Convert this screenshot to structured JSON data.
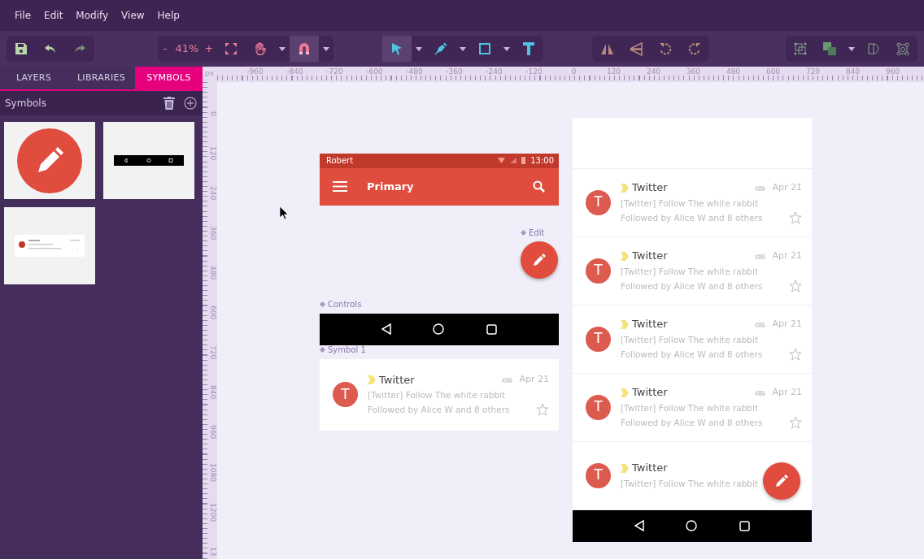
{
  "menu": [
    "File",
    "Edit",
    "Modify",
    "View",
    "Help"
  ],
  "toolbar": {
    "zoom_out": "-",
    "zoom": "41%",
    "zoom_in": "+",
    "redo_disabled": true,
    "hand_selected": false,
    "snap_selected": true,
    "pointer_selected": true
  },
  "panel": {
    "tabs": [
      {
        "label": "LAYERS",
        "selected": false
      },
      {
        "label": "LIBRARIES",
        "selected": false
      },
      {
        "label": "SYMBOLS",
        "selected": true
      }
    ],
    "title": "Symbols",
    "symbols": [
      {
        "kind": "fab"
      },
      {
        "kind": "nav-bar"
      },
      {
        "kind": "list-item"
      }
    ]
  },
  "rulers": {
    "unit": "px",
    "x_labels": [
      "-960",
      "-840",
      "-720",
      "-600",
      "-480",
      "-360",
      "-240",
      "-120",
      "0",
      "120",
      "240",
      "360",
      "480",
      "600",
      "720",
      "840",
      "960"
    ],
    "y_labels": [
      "0",
      "120",
      "240",
      "360",
      "480",
      "600",
      "720",
      "840",
      "960",
      "1080",
      "1200",
      "13"
    ]
  },
  "canvas": {
    "app_bar": {
      "account": "Robert",
      "time": "13:00",
      "title": "Primary"
    },
    "edit_label": "Edit",
    "controls_label": "Controls",
    "symbol_label": "Symbol 1",
    "symbol_card": {
      "avatar": "T",
      "sender": "Twitter",
      "date": "Apr 21",
      "subject": "[Twitter] Follow The white rabbit",
      "snippet": "Followed by Alice W and 8 others",
      "starred": false
    },
    "phone_mails": [
      {
        "avatar": "T",
        "sender": "Twitter",
        "date": "Apr 21",
        "subject": "[Twitter] Follow The white rabbit",
        "snippet": "Followed by Alice W and 8 others",
        "starred": false
      },
      {
        "avatar": "T",
        "sender": "Twitter",
        "date": "Apr 21",
        "subject": "[Twitter] Follow The white rabbit",
        "snippet": "Followed by Alice W and 8 others",
        "starred": false
      },
      {
        "avatar": "T",
        "sender": "Twitter",
        "date": "Apr 21",
        "subject": "[Twitter] Follow The white rabbit",
        "snippet": "Followed by Alice W and 8 others",
        "starred": false
      },
      {
        "avatar": "T",
        "sender": "Twitter",
        "date": "Apr 21",
        "subject": "[Twitter] Follow The white rabbit",
        "snippet": "Followed by Alice W and 8 others",
        "starred": false
      },
      {
        "avatar": "T",
        "sender": "Twitter",
        "subject": "[Twitter] Follow The white rabbit"
      }
    ]
  }
}
